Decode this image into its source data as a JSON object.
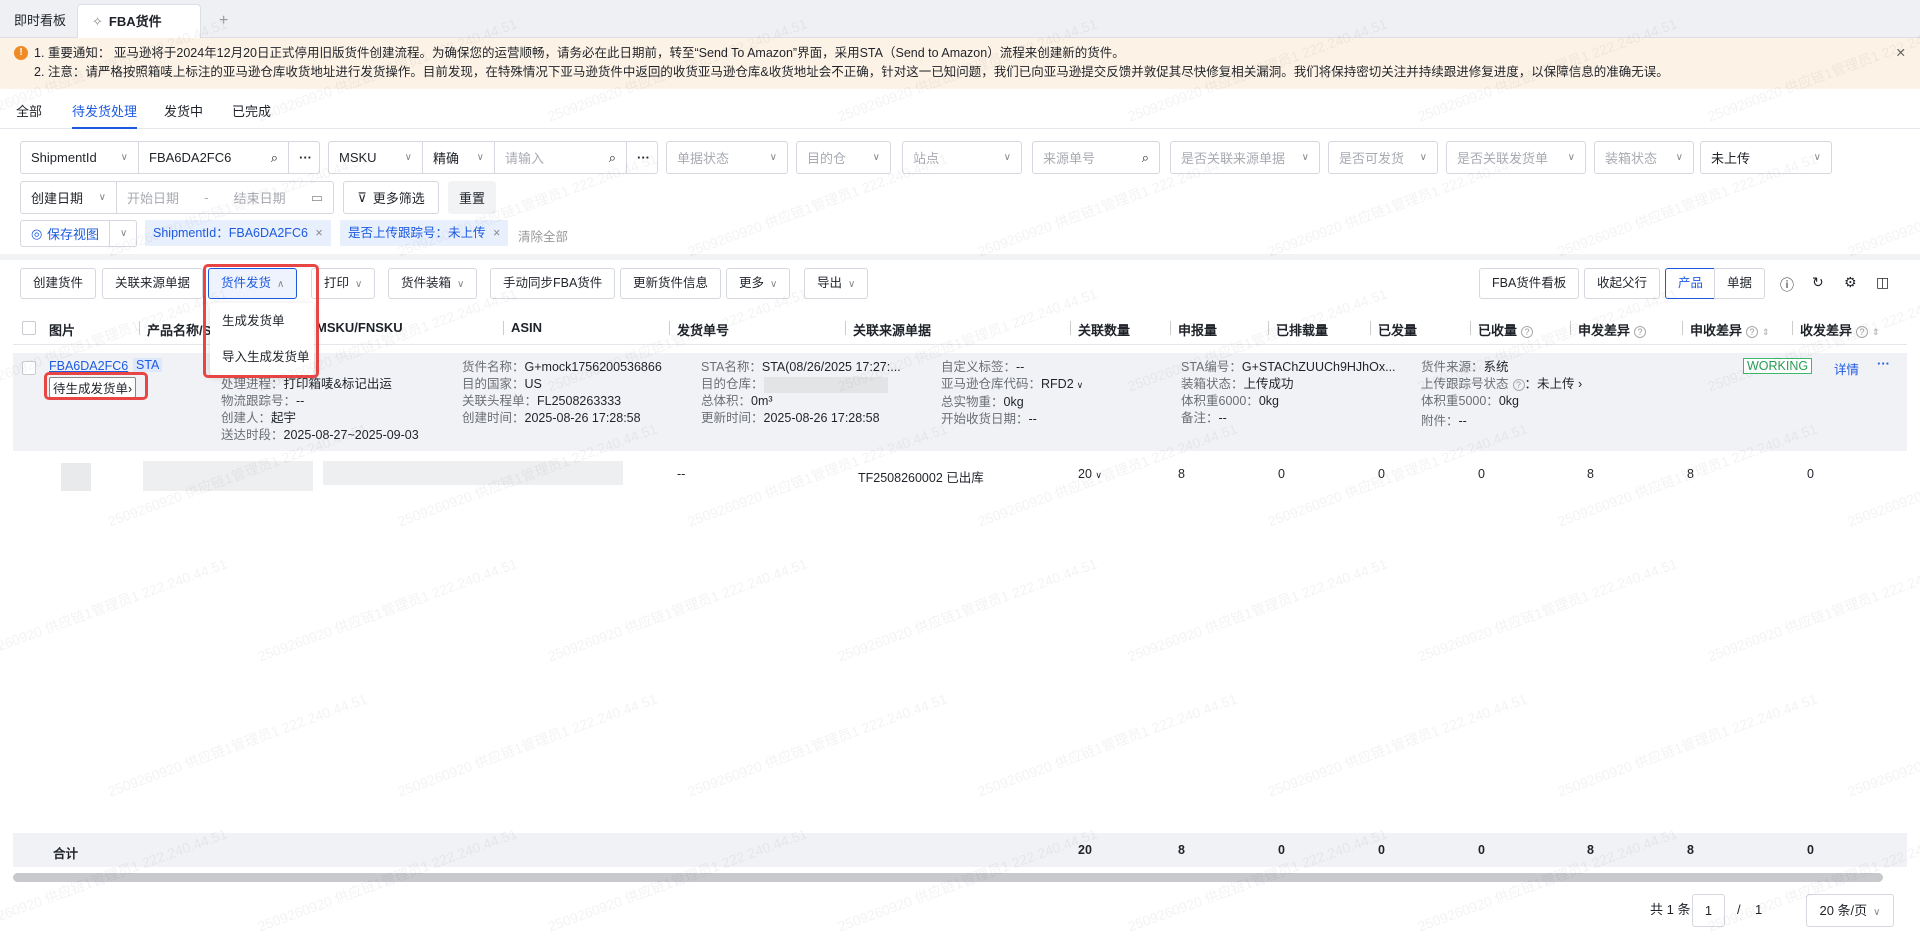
{
  "tabs": [
    {
      "label": "即时看板"
    },
    {
      "label": "FBA货件",
      "icon": "pin-icon"
    }
  ],
  "notice": {
    "line1": "1. 重要通知： 亚马逊将于2024年12月20日正式停用旧版货件创建流程。为确保您的运营顺畅，请务必在此日期前，转至“Send To Amazon”界面，采用STA（Send to Amazon）流程来创建新的货件。",
    "line2": "2. 注意：请严格按照箱唛上标注的亚马逊仓库收货地址进行发货操作。目前发现，在特殊情况下亚马逊货件中返回的收货亚马逊仓库&收货地址会不正确，针对这一已知问题，我们已向亚马逊提交反馈并敦促其尽快修复相关漏洞。我们将保持密切关注并持续跟进修复进度，以保障信息的准确无误。"
  },
  "subtabs": [
    "全部",
    "待发货处理",
    "发货中",
    "已完成"
  ],
  "filters": {
    "id_type": "ShipmentId",
    "id_value": "FBA6DA2FC6",
    "msku_type": "MSKU",
    "match": "精确",
    "msku_placeholder": "请输入",
    "status": "单据状态",
    "dest": "目的仓",
    "site": "站点",
    "source_no": "来源单号",
    "linked_source": "是否关联来源单据",
    "can_ship": "是否可发货",
    "linked_ship": "是否关联发货单",
    "pack_status": "装箱状态",
    "upload": "未上传",
    "date_type": "创建日期",
    "start": "开始日期",
    "end": "结束日期",
    "more": "更多筛选",
    "reset": "重置",
    "save_view": "保存视图",
    "tags": [
      "ShipmentId：FBA6DA2FC6",
      "是否上传跟踪号：未上传"
    ],
    "clear": "清除全部"
  },
  "toolbar": {
    "create": "创建货件",
    "link_source": "关联来源单据",
    "ship": "货件发货",
    "print": "打印",
    "pack": "货件装箱",
    "sync": "手动同步FBA货件",
    "update": "更新货件信息",
    "more": "更多",
    "export": "导出",
    "board": "FBA货件看板",
    "collapse": "收起父行",
    "view_product": "产品",
    "view_doc": "单据"
  },
  "ship_menu": [
    "生成发货单",
    "导入生成发货单"
  ],
  "columns": [
    "图片",
    "产品名称/SKU",
    "MSKU/FNSKU",
    "ASIN",
    "发货单号",
    "关联来源单据",
    "关联数量",
    "申报量",
    "已排载量",
    "已发量",
    "已收量",
    "申发差异",
    "申收差异",
    "收发差异"
  ],
  "shipment": {
    "id": "FBA6DA2FC6",
    "type": "STA",
    "pending": "待生成发货单",
    "status": "WORKING",
    "detail": "详情",
    "col1": [
      [
        "处理进程：",
        "打印箱唛&标记出运"
      ],
      [
        "物流跟踪号：",
        "--"
      ],
      [
        "创建人：",
        "起宇"
      ],
      [
        "送达时段：",
        "2025-08-27~2025-09-03"
      ]
    ],
    "col2": [
      [
        "货件名称：",
        "G+mock1756200536866"
      ],
      [
        "目的国家：",
        "US"
      ],
      [
        "关联头程单：",
        "FL2508263333"
      ],
      [
        "创建时间：",
        "2025-08-26 17:28:58"
      ]
    ],
    "col3": [
      [
        "STA名称：",
        "STA(08/26/2025 17:27:..."
      ],
      [
        "目的仓库：",
        ""
      ],
      [
        "总体积：",
        "0m³"
      ],
      [
        "更新时间：",
        "2025-08-26 17:28:58"
      ]
    ],
    "col4": [
      [
        "自定义标签：",
        "--"
      ],
      [
        "亚马逊仓库代码：",
        "RFD2"
      ],
      [
        "总实物重：",
        "0kg"
      ],
      [
        "开始收货日期：",
        "--"
      ]
    ],
    "col5": [
      [
        "STA编号：",
        "G+STAChZUUCh9HJhOx..."
      ],
      [
        "装箱状态：",
        "上传成功"
      ],
      [
        "体积重6000：",
        "0kg"
      ],
      [
        "备注：",
        "--"
      ]
    ],
    "col6": [
      [
        "货件来源：",
        "系统"
      ],
      [
        "上传跟踪号状态",
        "：未上传"
      ],
      [
        "体积重5000：",
        "0kg"
      ],
      [
        "附件：",
        "--"
      ]
    ]
  },
  "item": {
    "ship_no": "--",
    "source": "TF2508260002 已出库",
    "linked": "20",
    "declared": "8",
    "scheduled": "0",
    "shipped": "0",
    "received": "0",
    "diff_ds": "8",
    "diff_dr": "8",
    "diff_sr": "0"
  },
  "total": {
    "label": "合计",
    "linked": "20",
    "declared": "8",
    "scheduled": "0",
    "shipped": "0",
    "received": "0",
    "diff_ds": "8",
    "diff_dr": "8",
    "diff_sr": "0"
  },
  "pagination": {
    "total": "共 1 条",
    "page": "1",
    "sep": "/",
    "pages": "1",
    "size": "20 条/页"
  },
  "watermark": "2509260920 供应链1管理员1 222.240.44.51"
}
